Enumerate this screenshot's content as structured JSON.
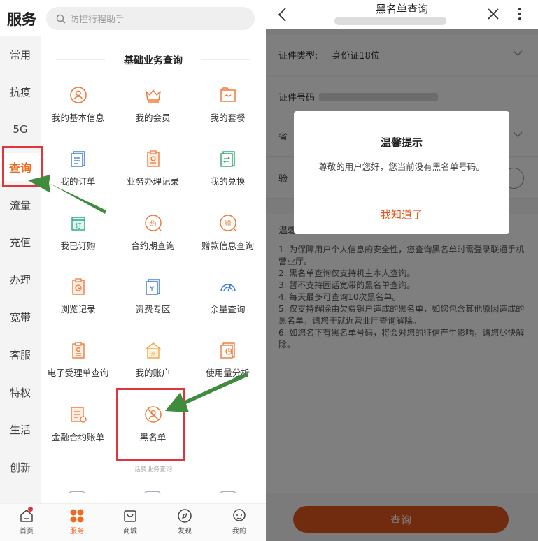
{
  "left": {
    "app_title": "服务",
    "search_placeholder": "防控行程助手",
    "sidebar": [
      "常用",
      "抗疫",
      "5G",
      "查询",
      "流量",
      "充值",
      "办理",
      "宽带",
      "客服",
      "特权",
      "生活",
      "创新"
    ],
    "active_sidebar": "查询",
    "section_title": "基础业务查询",
    "items": [
      {
        "label": "我的基本信息",
        "icon": "user-circle-icon"
      },
      {
        "label": "我的会员",
        "icon": "crown-icon"
      },
      {
        "label": "我的套餐",
        "icon": "package-icon"
      },
      {
        "label": "我的订单",
        "icon": "order-icon"
      },
      {
        "label": "业务办理记录",
        "icon": "clipboard-icon"
      },
      {
        "label": "我的兑换",
        "icon": "exchange-icon"
      },
      {
        "label": "我已订购",
        "icon": "subscribed-icon"
      },
      {
        "label": "合约期查询",
        "icon": "contract-icon"
      },
      {
        "label": "赠款信息查询",
        "icon": "gift-money-icon"
      },
      {
        "label": "浏览记录",
        "icon": "history-icon"
      },
      {
        "label": "资费专区",
        "icon": "tariff-icon"
      },
      {
        "label": "余量查询",
        "icon": "gauge-icon"
      },
      {
        "label": "电子受理单查询",
        "icon": "e-receipt-icon"
      },
      {
        "label": "我的账户",
        "icon": "account-icon"
      },
      {
        "label": "使用量分析",
        "icon": "usage-analysis-icon"
      },
      {
        "label": "金融合约账单",
        "icon": "finance-bill-icon"
      },
      {
        "label": "黑名单",
        "icon": "blacklist-icon"
      }
    ],
    "subsection_title": "话费业务查询",
    "tabs": [
      {
        "label": "首页",
        "icon": "home-icon"
      },
      {
        "label": "服务",
        "icon": "service-icon"
      },
      {
        "label": "商城",
        "icon": "shop-icon"
      },
      {
        "label": "发现",
        "icon": "compass-icon"
      },
      {
        "label": "我的",
        "icon": "profile-icon"
      }
    ],
    "accent": "#f06a1e"
  },
  "right": {
    "title": "黑名单查询",
    "id_type_label": "证件类型:",
    "id_type_value": "身份证18位",
    "id_number_label": "证件号码",
    "province_label": "省",
    "captcha_label": "验",
    "tips_title": "温馨提示",
    "tips": [
      "1. 为保障用户个人信息的安全性，您查询黑名单时需登录联通手机营业厅。",
      "2. 黑名单查询仅支持机主本人查询。",
      "3. 暂不支持固话宽带的黑名单查询。",
      "4. 每天最多可查询10次黑名单。",
      "5. 仅支持解除由欠费销户造成的黑名单，如您包含其他原因造成的黑名单，请您于就近营业厅查询解除。",
      "6. 如您名下有黑名单号码，将会对您的征信产生影响，请您尽快解除。"
    ],
    "query_button": "查询",
    "dialog": {
      "title": "温馨提示",
      "message": "尊敬的用户您好，您当前没有黑名单号码。",
      "ok": "我知道了"
    },
    "accent": "#e3571e"
  }
}
